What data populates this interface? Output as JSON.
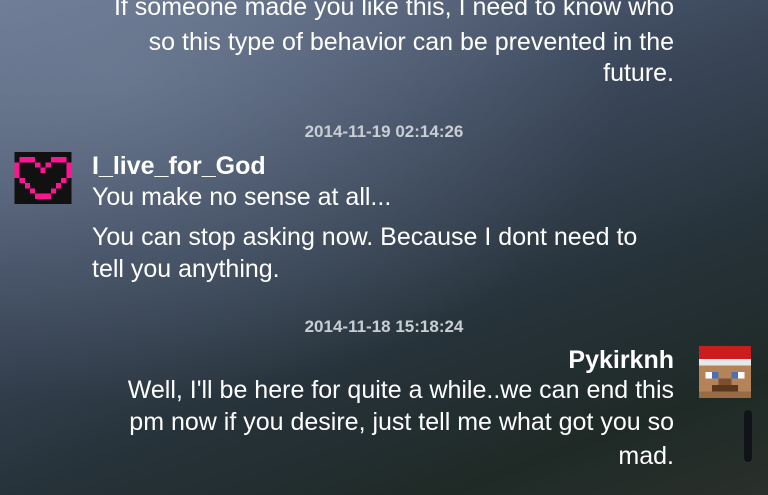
{
  "messages": [
    {
      "lines": [
        "If someone made you like this, I need to know who",
        "so this type of behavior can be prevented in the",
        "future."
      ]
    },
    {
      "timestamp": "2014-11-19 02:14:26",
      "username": "I_live_for_God",
      "avatar_icon": "pink-heart-icon",
      "lines": [
        "You make no sense at all...",
        "You can stop asking now. Because I dont need to",
        "tell you anything."
      ]
    },
    {
      "timestamp": "2014-11-18 15:18:24",
      "username": "Pykirknh",
      "avatar_icon": "santa-hat-face-icon",
      "lines": [
        "Well, I'll be here for quite a while..we can end this",
        "pm now if you desire, just tell me what got you so",
        "mad."
      ]
    }
  ],
  "colors": {
    "heart": "#ff1493",
    "timestamp": "#c9ced3"
  }
}
